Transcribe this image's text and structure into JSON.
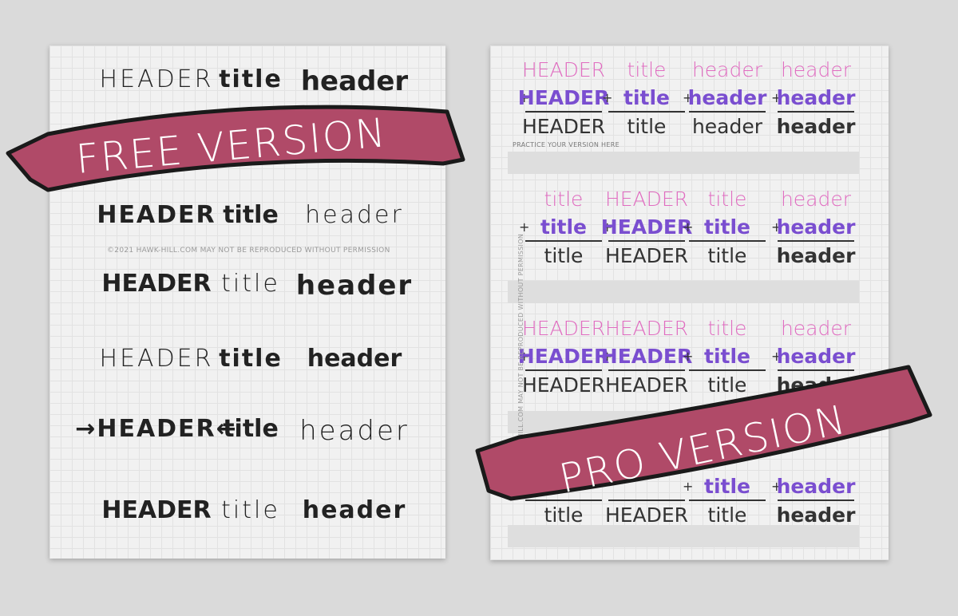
{
  "free_page": {
    "rows": [
      [
        "HEADER",
        "title",
        "header"
      ],
      [
        "HEADER",
        "title",
        "header"
      ],
      [
        "HEADER",
        "title",
        "header"
      ],
      [
        "HEADER",
        "title",
        "header"
      ],
      [
        "→HEADER←",
        "title",
        "header"
      ],
      [
        "HEADER",
        "title",
        "header"
      ]
    ],
    "copyright": "©2021 HAWK-HILL.COM MAY NOT BE REPRODUCED WITHOUT PERMISSION"
  },
  "pro_page": {
    "blocks": [
      [
        {
          "top": "HEADER",
          "mid": "HEADER",
          "bot": "HEADER"
        },
        {
          "top": "title",
          "mid": "title",
          "bot": "title"
        },
        {
          "top": "header",
          "mid": "header",
          "bot": "header"
        },
        {
          "top": "header",
          "mid": "header",
          "bot": "header"
        }
      ],
      [
        {
          "top": "title",
          "mid": "title",
          "bot": "title"
        },
        {
          "top": "HEADER",
          "mid": "HEADER",
          "bot": "HEADER"
        },
        {
          "top": "title",
          "mid": "title",
          "bot": "title"
        },
        {
          "top": "header",
          "mid": "header",
          "bot": "header"
        }
      ],
      [
        {
          "top": "HEADER",
          "mid": "HEADER",
          "bot": "HEADER"
        },
        {
          "top": "HEADER",
          "mid": "HEADER",
          "bot": "HEADER"
        },
        {
          "top": "title",
          "mid": "title",
          "bot": "title"
        },
        {
          "top": "header",
          "mid": "header",
          "bot": "header"
        }
      ],
      [
        {
          "top": "",
          "mid": "",
          "bot": "title"
        },
        {
          "top": "",
          "mid": "",
          "bot": "HEADER"
        },
        {
          "top": "",
          "mid": "title",
          "bot": "title"
        },
        {
          "top": "",
          "mid": "header",
          "bot": "header"
        }
      ]
    ],
    "plus": "+",
    "practice_label": "PRACTICE YOUR VERSION HERE",
    "copyright": "©2021 HAWK-HILL.COM MAY NOT BE REPRODUCED WITHOUT PERMISSION"
  },
  "ribbons": {
    "free": "FREE VERSION",
    "pro": "PRO VERSION",
    "color": "#b04a68"
  }
}
